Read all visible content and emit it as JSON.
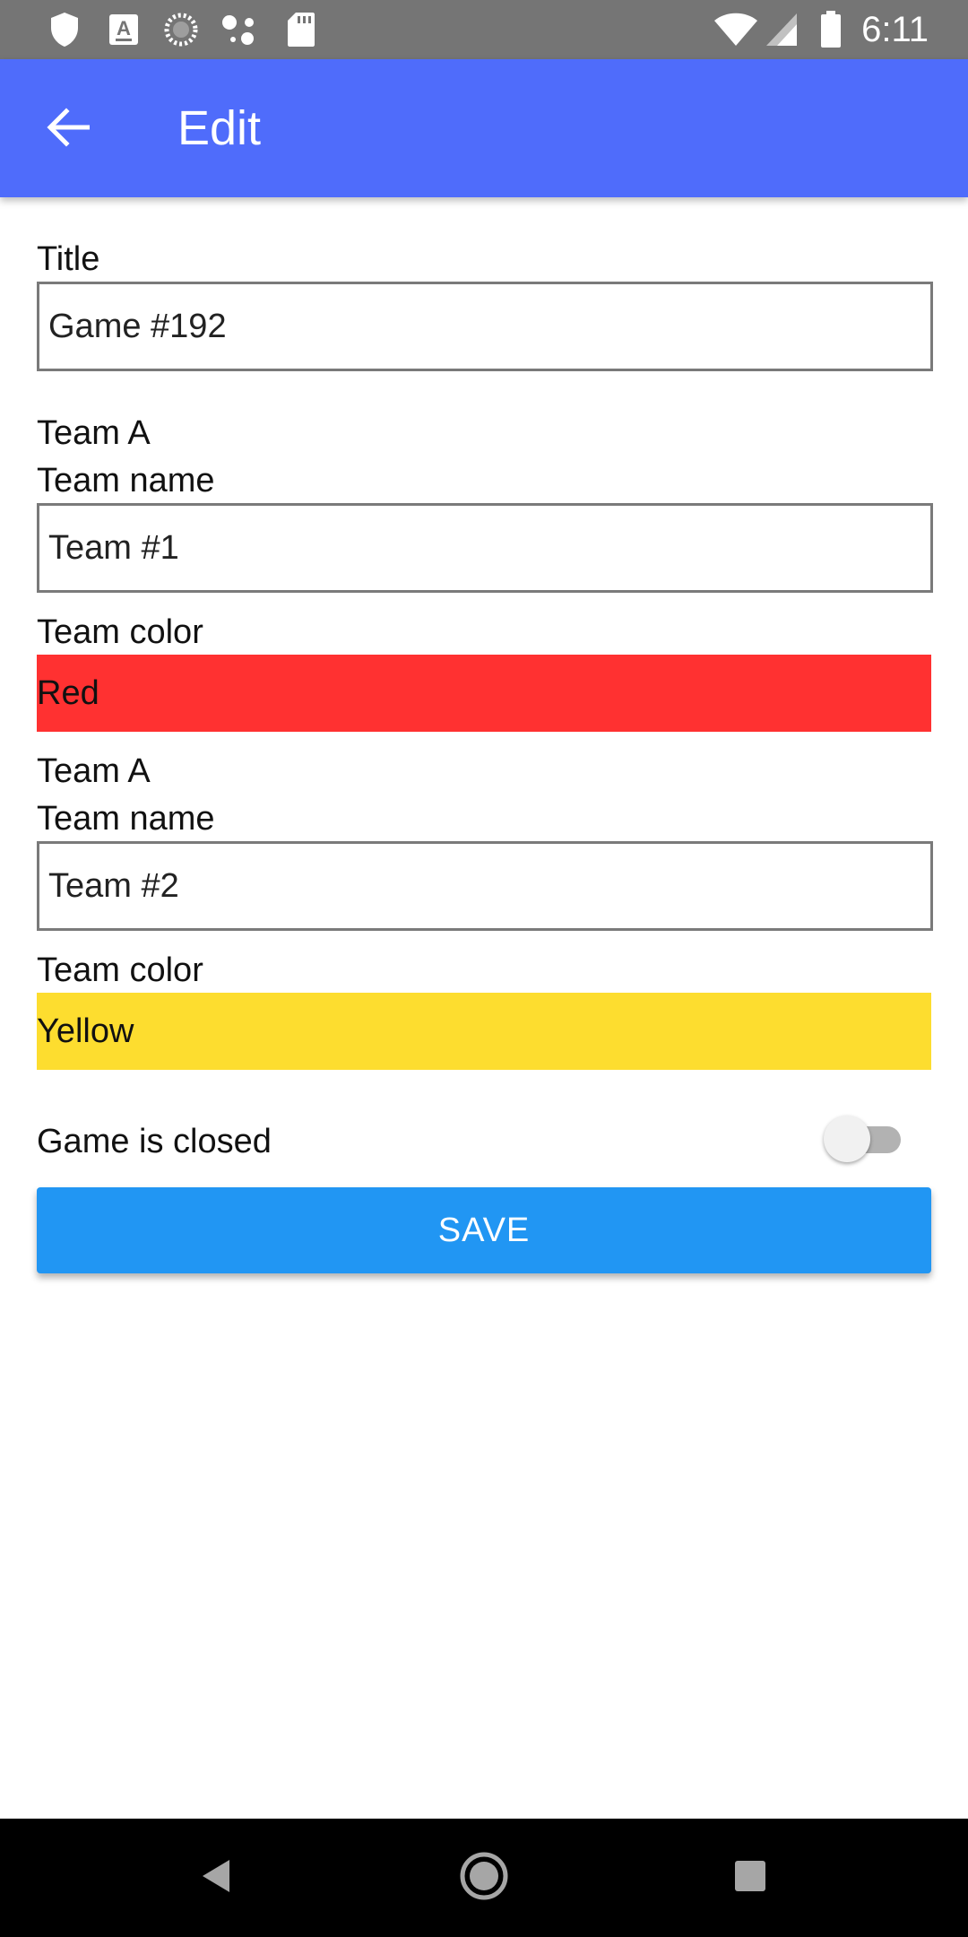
{
  "status_bar": {
    "time": "6:11",
    "icons": [
      "shield-icon",
      "keyboard-a-icon",
      "loading-spinner-icon",
      "assistant-dots-icon",
      "sd-card-icon",
      "wifi-icon",
      "signal-icon",
      "battery-icon"
    ]
  },
  "app_bar": {
    "title": "Edit",
    "back_icon": "arrow-back-icon"
  },
  "form": {
    "title_label": "Title",
    "title_value": "Game #192",
    "team_a": {
      "heading": "Team A",
      "name_label": "Team name",
      "name_value": "Team #1",
      "color_label": "Team color",
      "color_value": "Red",
      "color_hex": "#ff3131"
    },
    "team_b": {
      "heading": "Team A",
      "name_label": "Team name",
      "name_value": "Team #2",
      "color_label": "Team color",
      "color_value": "Yellow",
      "color_hex": "#fddd2f"
    },
    "closed_label": "Game is closed",
    "closed_on": false,
    "save_label": "SAVE"
  },
  "colors": {
    "status_bar": "#757575",
    "app_bar": "#4f6cfb",
    "save_button": "#2196f3",
    "nav_bar": "#000000"
  },
  "nav_bar": {
    "buttons": [
      "back-triangle-icon",
      "home-circle-icon",
      "recents-square-icon"
    ]
  }
}
